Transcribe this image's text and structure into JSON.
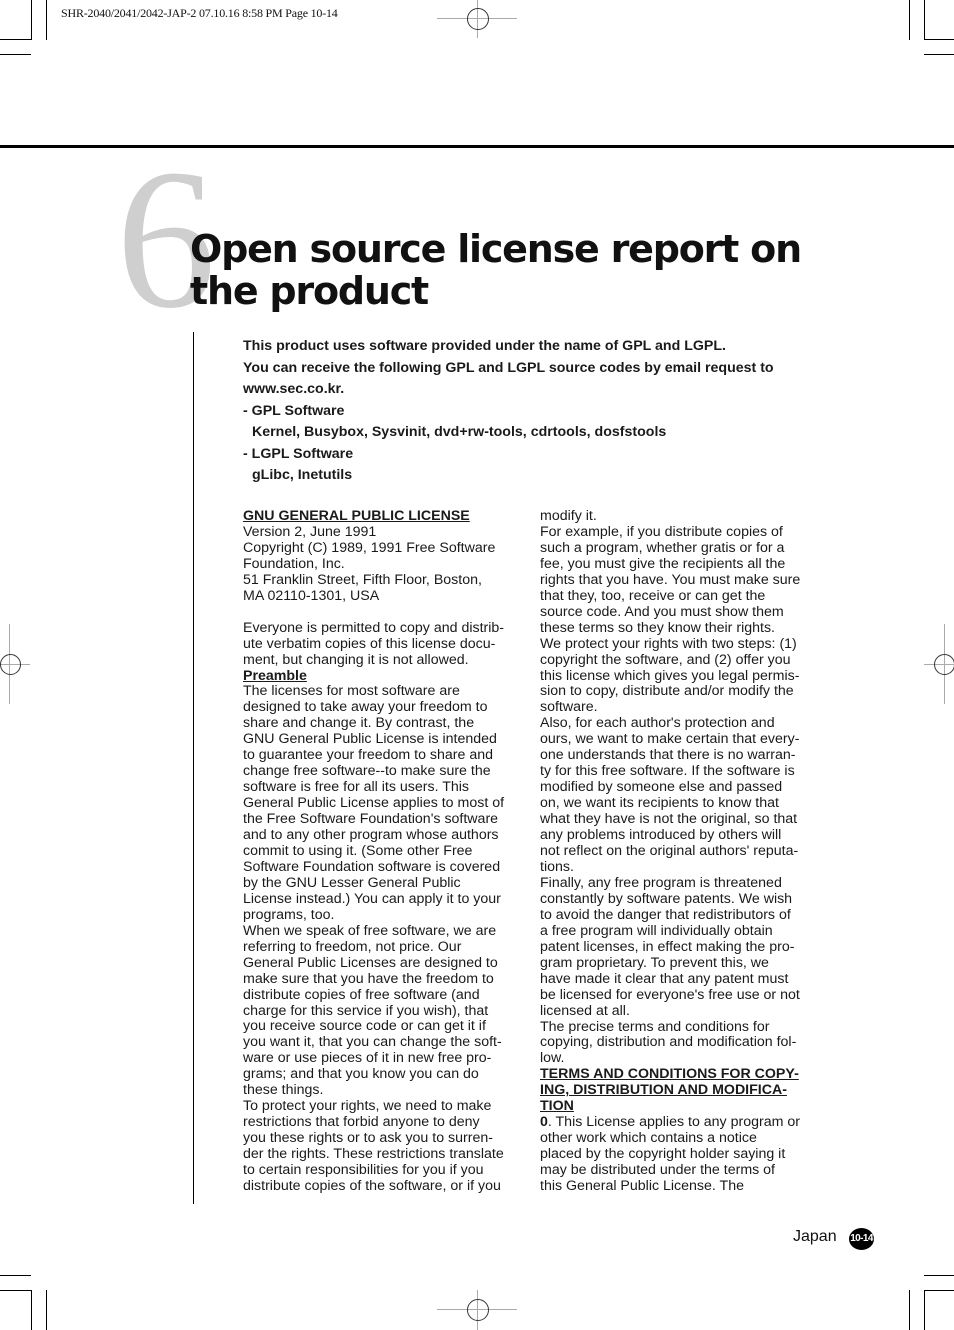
{
  "print_slug": "SHR-2040/2041/2042-JAP-2  07.10.16 8:58 PM  Page 10-14",
  "chapter": {
    "number": "6",
    "title_lines": [
      "Open source license report on",
      "the product"
    ]
  },
  "intro": {
    "lines": [
      "This product uses software provided under the name of GPL and LGPL.",
      "You can receive the following GPL and LGPL source codes by email request to",
      "www.sec.co.kr.",
      "- GPL Software",
      "Kernel, Busybox, Sysvinit, dvd+rw-tools, cdrtools, dosfstools",
      "- LGPL Software",
      "gLibc, Inetutils"
    ]
  },
  "column1": {
    "heading": "GNU GENERAL PUBLIC LICENSE",
    "header_lines": [
      "Version 2, June 1991",
      "Copyright (C) 1989, 1991 Free Software",
      "Foundation, Inc.",
      "51 Franklin Street, Fifth Floor, Boston,",
      "MA  02110-1301, USA"
    ],
    "notice_lines": [
      "Everyone is permitted to copy and distrib-",
      "ute verbatim copies of this license docu-",
      "ment, but changing it is not allowed."
    ],
    "preamble_heading": "Preamble",
    "body_lines": [
      "The licenses for most software are",
      "designed to take away your freedom to",
      "share and change it. By contrast, the",
      "GNU General Public License is intended",
      "to guarantee your freedom to share and",
      "change free software--to make sure the",
      "software is free for all its users. This",
      "General Public License applies to most of",
      "the Free Software Foundation's software",
      "and to any other program whose authors",
      "commit to using it. (Some other Free",
      "Software Foundation software is covered",
      "by the GNU Lesser General Public",
      "License instead.) You can apply it to your",
      "programs, too.",
      "When we speak of free software, we are",
      "referring to freedom, not price. Our",
      "General Public Licenses are designed to",
      "make sure that you have the freedom to",
      "distribute copies of free software (and",
      "charge for this service if you wish), that",
      "you receive source code or can get it if",
      "you want it, that you can change the soft-",
      "ware or use pieces of it in new free pro-",
      "grams; and that you know you can do",
      "these things.",
      "To protect your rights, we need to make",
      "restrictions that forbid anyone to deny",
      "you these rights or to ask you to surren-",
      "der the rights. These restrictions translate",
      "to certain responsibilities for you if you",
      "distribute copies of the software, or if you"
    ]
  },
  "column2": {
    "body_lines": [
      "modify it.",
      "For example, if you distribute copies of",
      "such a program, whether gratis or for a",
      "fee, you must give the recipients all the",
      "rights that you have. You must make sure",
      "that they, too, receive or can get the",
      "source code. And you must show them",
      "these terms so they know their rights.",
      "We protect your rights with two steps: (1)",
      "copyright the software, and (2) offer you",
      "this license which gives you legal permis-",
      "sion to copy, distribute and/or modify the",
      "software.",
      "Also, for each author's protection and",
      "ours, we want to make certain that every-",
      "one understands that there is no warran-",
      "ty for this free software. If the software is",
      "modified by someone else and passed",
      "on, we want its recipients to know that",
      "what they have is not the original, so that",
      "any problems introduced by others will",
      "not reflect on the original authors' reputa-",
      "tions.",
      "Finally, any free program is threatened",
      "constantly by software patents. We wish",
      "to avoid the danger that redistributors of",
      "a free program will individually obtain",
      "patent licenses, in effect making the pro-",
      "gram proprietary. To prevent this, we",
      "have made it clear that any patent must",
      "be licensed for everyone's free use or not",
      "licensed at all.",
      "The precise terms and conditions for",
      "copying, distribution and modification fol-",
      "low."
    ],
    "terms_heading_lines": [
      "TERMS AND CONDITIONS FOR COPY-",
      "ING, DISTRIBUTION AND MODIFICA-",
      "TION"
    ],
    "clause0_number": "0",
    "clause0_first_line_rest": ". This License applies to any program or",
    "clause0_lines": [
      "other work which contains a notice",
      "placed by the copyright holder saying it",
      "may be distributed under the terms of",
      "this General Public License. The"
    ]
  },
  "footer": {
    "region": "Japan",
    "page_number": "10-14"
  }
}
